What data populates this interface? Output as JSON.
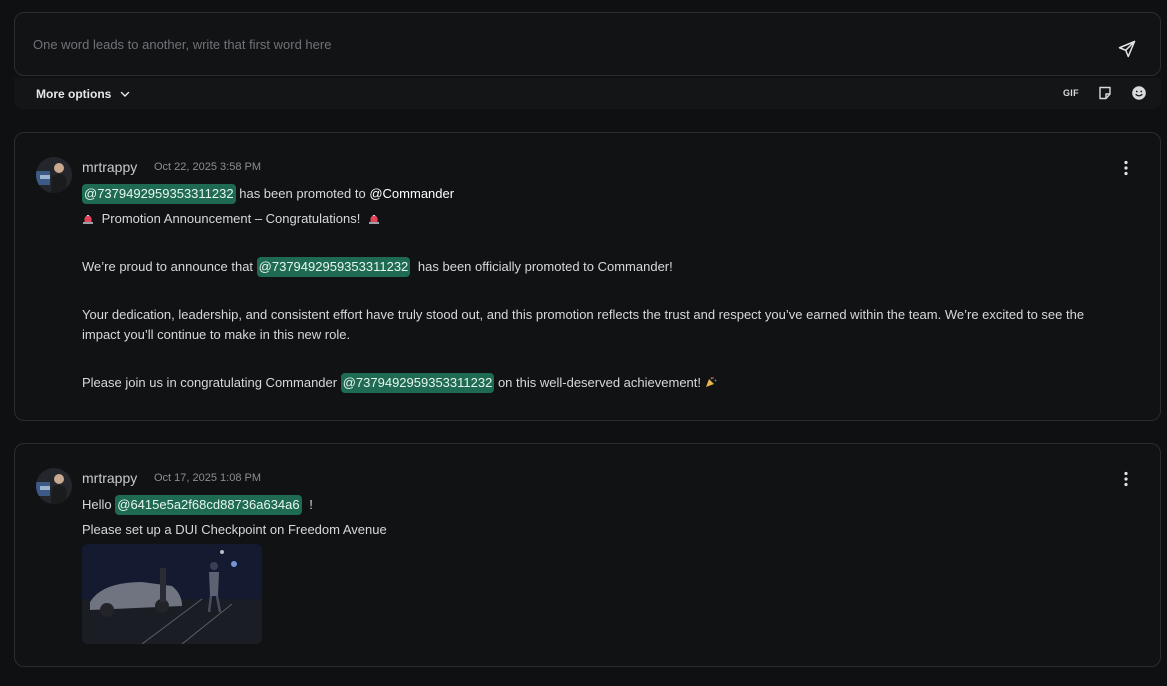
{
  "composer": {
    "placeholder": "One word leads to another, write that first word here"
  },
  "options_bar": {
    "more_options_label": "More options",
    "gif_label": "GIF"
  },
  "posts": [
    {
      "author": "mrtrappy",
      "timestamp": "Oct 22, 2025 3:58 PM",
      "line1_mention": "@7379492959353311232",
      "line1_text": "has been promoted to",
      "line1_role": "@Commander",
      "line2_text": "Promotion Announcement – Congratulations!",
      "para1_prefix": "We’re proud to announce that",
      "para1_mention": "@7379492959353311232",
      "para1_suffix": "has been officially promoted to Commander!",
      "para2": "Your dedication, leadership, and consistent effort have truly stood out, and this promotion reflects the trust and respect you’ve earned within the team. We’re excited to see the impact you’ll continue to make in this new role.",
      "para3_prefix": "Please join us in congratulating Commander",
      "para3_mention": "@7379492959353311232",
      "para3_suffix": "on this well-deserved achievement!"
    },
    {
      "author": "mrtrappy",
      "timestamp": "Oct 17, 2025 1:08 PM",
      "line1_prefix": "Hello",
      "line1_mention": "@6415e5a2f68cd88736a634a6",
      "line1_suffix": "!",
      "line2_text": "Please set up a DUI Checkpoint on Freedom Avenue"
    }
  ],
  "colors": {
    "background": "#0f1011",
    "card_border": "#2a2c30",
    "mention_bg": "#1f6a52",
    "text": "#d7d8da"
  },
  "icons": [
    "send-icon",
    "chevron-down-icon",
    "gif-icon",
    "sticker-icon",
    "emoji-icon",
    "kebab-menu-icon",
    "siren-icon",
    "party-popper-icon"
  ]
}
